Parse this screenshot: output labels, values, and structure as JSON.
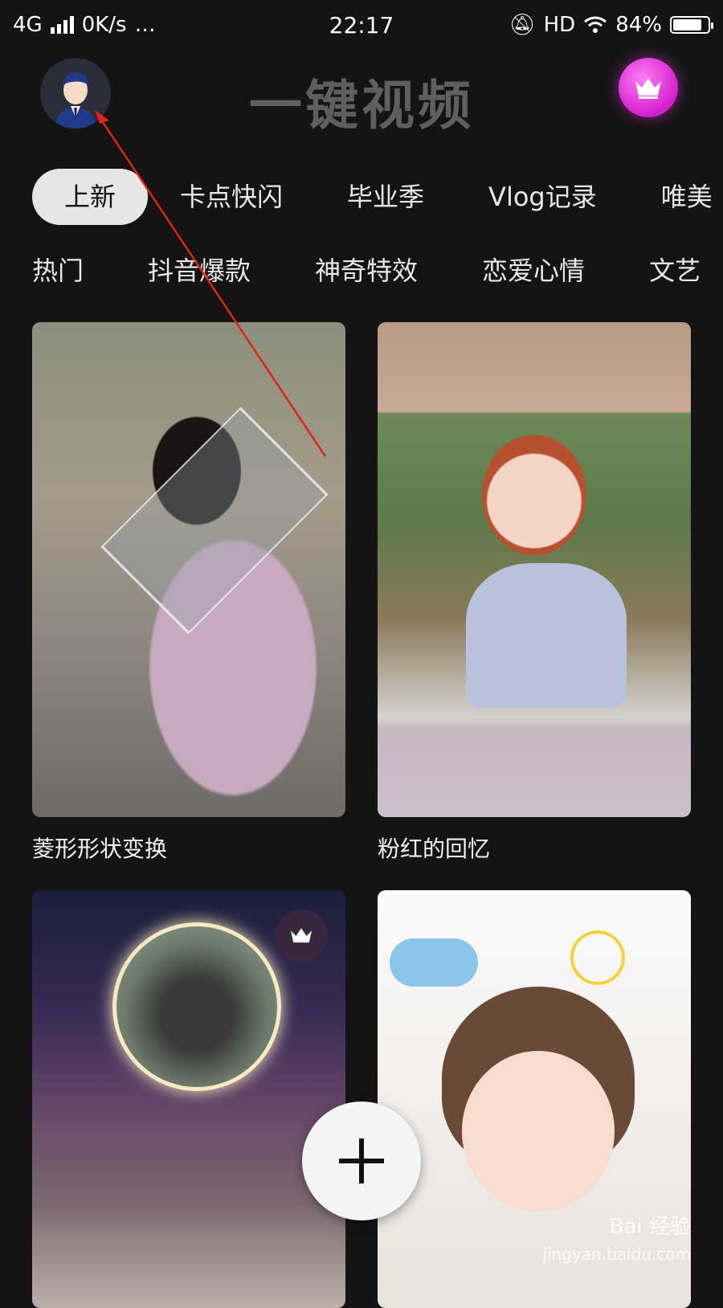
{
  "status_bar": {
    "network": "4G",
    "speed": "0K/s",
    "extra_icons": "…",
    "time": "22:17",
    "hd": "HD",
    "battery_percent": "84%",
    "battery_level": 0.84
  },
  "header": {
    "title": "一键视频",
    "avatar_icon": "user-avatar-icon",
    "vip_icon": "crown-icon",
    "vip_color": "#e23fde"
  },
  "tabs_row1": [
    "上新",
    "卡点快闪",
    "毕业季",
    "Vlog记录",
    "唯美"
  ],
  "tabs_row2": [
    "热门",
    "抖音爆款",
    "神奇特效",
    "恋爱心情",
    "文艺"
  ],
  "cards": [
    {
      "label": "菱形形状变换"
    },
    {
      "label": "粉红的回忆"
    },
    {
      "label": ""
    },
    {
      "label": ""
    }
  ],
  "fab": {
    "icon": "plus-icon"
  },
  "watermark": {
    "brand": "Bai 经验",
    "url": "jingyan.baidu.com"
  }
}
